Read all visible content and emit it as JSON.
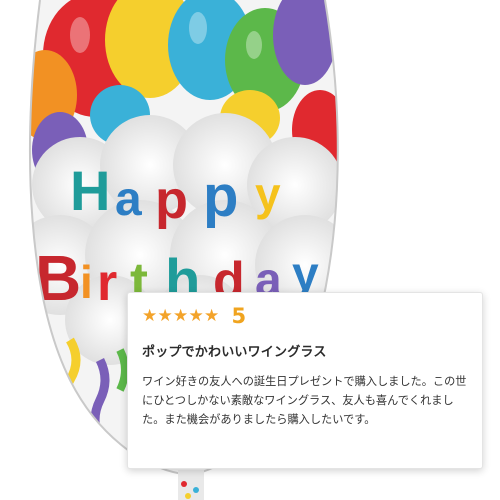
{
  "image": {
    "banner_text_line1": "Happy",
    "banner_text_line2": "Birthday",
    "colors": {
      "balloon_red": "#e0292f",
      "balloon_orange": "#f29123",
      "balloon_yellow": "#f5cf2d",
      "balloon_blue": "#3ab1d8",
      "balloon_green": "#5cb84a",
      "balloon_purple": "#7a5fb8",
      "letter_teal": "#1f9c9a",
      "letter_blue": "#2d7ec4",
      "letter_red": "#c7272e",
      "letter_yellow": "#f5c21c",
      "letter_green": "#7cb83a"
    }
  },
  "review": {
    "stars_filled": 5,
    "stars_total": 5,
    "rating": "5",
    "title": "ポップでかわいいワイングラス",
    "body": "ワイン好きの友人への誕生日プレゼントで購入しました。この世にひとつしかない素敵なワイングラス、友人も喜んでくれました。また機会がありましたら購入したいです。",
    "star_color": "#f3a32a"
  }
}
